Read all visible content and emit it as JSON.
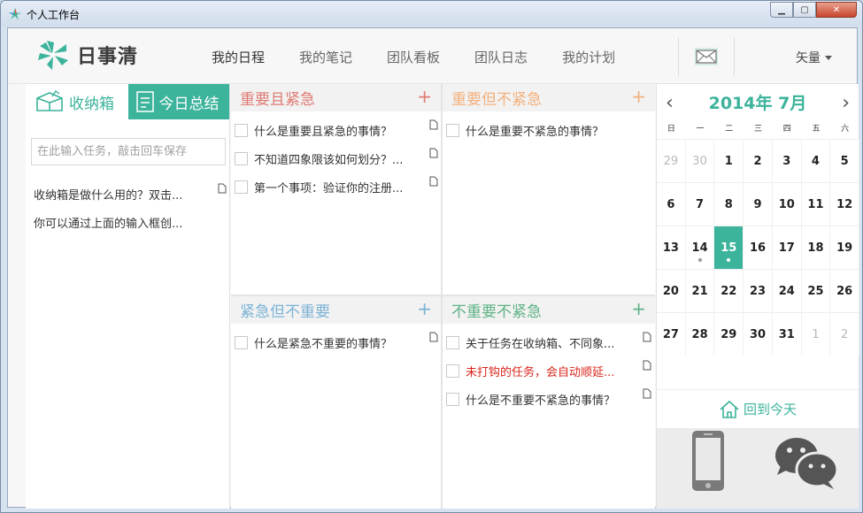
{
  "window": {
    "title": "个人工作台"
  },
  "header": {
    "logo_text": "日事清",
    "nav": [
      {
        "label": "我的日程",
        "active": true
      },
      {
        "label": "我的笔记"
      },
      {
        "label": "团队看板"
      },
      {
        "label": "团队日志"
      },
      {
        "label": "我的计划"
      }
    ],
    "mail_icon": "mail-icon",
    "user_name": "矢量"
  },
  "inbox": {
    "tab_inbox": "收纳箱",
    "tab_summary": "今日总结",
    "input_placeholder": "在此输入任务，敲击回车保存",
    "items": [
      "收纳箱是做什么用的？双击...",
      "你可以通过上面的输入框创..."
    ]
  },
  "quadrants": {
    "q1": {
      "title": "重要且紧急",
      "color": "#e07b73",
      "items": [
        "什么是重要且紧急的事情？",
        "不知道四象限该如何划分？...",
        "第一个事项：验证你的注册..."
      ]
    },
    "q2": {
      "title": "重要但不紧急",
      "color": "#f3b07c",
      "items": [
        "什么是重要不紧急的事情？"
      ]
    },
    "q3": {
      "title": "紧急但不重要",
      "color": "#7ab3d6",
      "items": [
        "什么是紧急不重要的事情？"
      ]
    },
    "q4": {
      "title": "不重要不紧急",
      "color": "#5fb386",
      "items": [
        {
          "text": "关于任务在收纳箱、不同象...",
          "overdue": false
        },
        {
          "text": "未打钩的任务，会自动顺延...",
          "overdue": true
        },
        {
          "text": "什么是不重要不紧急的事情？",
          "overdue": false
        }
      ]
    }
  },
  "calendar": {
    "title": "2014年 7月",
    "weekdays": [
      "日",
      "一",
      "二",
      "三",
      "四",
      "五",
      "六"
    ],
    "weeks": [
      [
        {
          "d": "29",
          "o": true
        },
        {
          "d": "30",
          "o": true
        },
        {
          "d": "1"
        },
        {
          "d": "2"
        },
        {
          "d": "3"
        },
        {
          "d": "4"
        },
        {
          "d": "5"
        }
      ],
      [
        {
          "d": "6"
        },
        {
          "d": "7"
        },
        {
          "d": "8"
        },
        {
          "d": "9"
        },
        {
          "d": "10"
        },
        {
          "d": "11"
        },
        {
          "d": "12"
        }
      ],
      [
        {
          "d": "13"
        },
        {
          "d": "14",
          "dot": true
        },
        {
          "d": "15",
          "today": true,
          "dot": true
        },
        {
          "d": "16"
        },
        {
          "d": "17"
        },
        {
          "d": "18"
        },
        {
          "d": "19"
        }
      ],
      [
        {
          "d": "20"
        },
        {
          "d": "21"
        },
        {
          "d": "22"
        },
        {
          "d": "23"
        },
        {
          "d": "24"
        },
        {
          "d": "25"
        },
        {
          "d": "26"
        }
      ],
      [
        {
          "d": "27"
        },
        {
          "d": "28"
        },
        {
          "d": "29"
        },
        {
          "d": "30"
        },
        {
          "d": "31"
        },
        {
          "d": "1",
          "o": true
        },
        {
          "d": "2",
          "o": true
        }
      ]
    ],
    "back_today": "回到今天"
  },
  "accent": "#3cb39b"
}
